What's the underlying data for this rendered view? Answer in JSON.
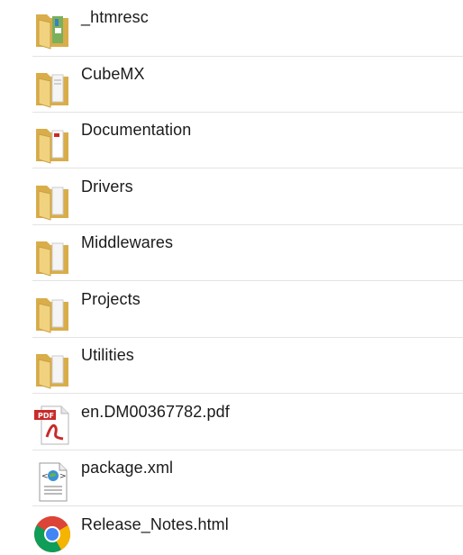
{
  "items": [
    {
      "name": "_htmresc",
      "icon": "folder-icon"
    },
    {
      "name": "CubeMX",
      "icon": "folder-icon"
    },
    {
      "name": "Documentation",
      "icon": "folder-icon"
    },
    {
      "name": "Drivers",
      "icon": "folder-icon"
    },
    {
      "name": "Middlewares",
      "icon": "folder-icon"
    },
    {
      "name": "Projects",
      "icon": "folder-icon"
    },
    {
      "name": "Utilities",
      "icon": "folder-icon"
    },
    {
      "name": "en.DM00367782.pdf",
      "icon": "pdf-file-icon"
    },
    {
      "name": "package.xml",
      "icon": "xml-file-icon"
    },
    {
      "name": "Release_Notes.html",
      "icon": "chrome-icon"
    }
  ],
  "colors": {
    "folder": "#e8c56a",
    "pdf": "#c92a2a",
    "chrome_red": "#db4437",
    "chrome_yellow": "#f4b400",
    "chrome_green": "#0f9d58",
    "chrome_blue": "#4285f4"
  }
}
